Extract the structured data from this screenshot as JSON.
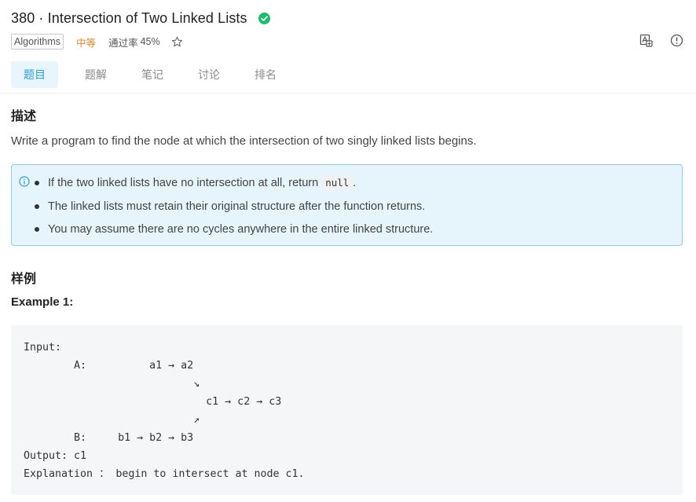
{
  "problem": {
    "title": "380 · Intersection of Two Linked Lists",
    "tag": "Algorithms",
    "difficulty": "中等",
    "pass_rate_label": "通过率",
    "pass_rate_value": "45%"
  },
  "tabs": [
    {
      "label": "题目",
      "active": true
    },
    {
      "label": "题解",
      "active": false
    },
    {
      "label": "笔记",
      "active": false
    },
    {
      "label": "讨论",
      "active": false
    },
    {
      "label": "排名",
      "active": false
    }
  ],
  "description": {
    "heading": "描述",
    "text": "Write a program to find the node at which the intersection of two singly linked lists begins."
  },
  "notice": {
    "item1_before": "If the two linked lists have no intersection at all, return ",
    "item1_code": "null",
    "item1_after": ".",
    "item2": "The linked lists must retain their original structure after the function returns.",
    "item3": "You may assume there are no cycles anywhere in the entire linked structure."
  },
  "examples": {
    "heading": "样例",
    "example1_label": "Example 1:",
    "example1_code": "Input:\n        A:          a1 → a2\n                           ↘\n                             c1 → c2 → c3\n                           ↗\n        B:     b1 → b2 → b3\nOutput: c1\nExplanation ： begin to intersect at node c1."
  },
  "colors": {
    "accent": "#2a9fd8",
    "success": "#19be6b",
    "difficulty": "#e6882e",
    "notice_bg": "#e6f4fb",
    "notice_border": "#91cbe9"
  }
}
